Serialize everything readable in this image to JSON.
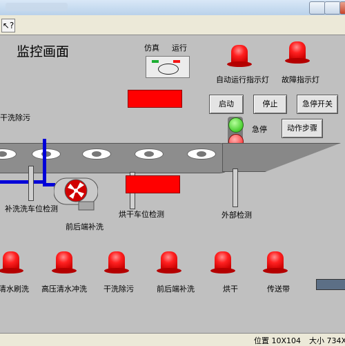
{
  "title_text": "监控画面",
  "mode_labels": {
    "sim": "仿真",
    "run": "运行"
  },
  "indicators": {
    "auto_run": "自动运行指示灯",
    "fault": "故障指示灯"
  },
  "buttons": {
    "start": "启动",
    "stop": "停止",
    "estop_switch": "急停开关",
    "action_steps": "动作步骤"
  },
  "estop_label": "急停",
  "process_labels": {
    "dry_clean": "干洗除污",
    "supplement_wash_detect": "补洗洗车位检测",
    "front_rear_wash": "前后端补洗",
    "dry_position_detect": "烘干车位检测",
    "external_detect": "外部检测"
  },
  "bottom_lamps": [
    "清水刷洗",
    "高压清水冲洗",
    "干洗除污",
    "前后端补洗",
    "烘干",
    "传送带"
  ],
  "status": {
    "position": "位置 10X104",
    "size": "大小 734X"
  },
  "colors": {
    "lamp_red": "#ff0000",
    "green_led": "#19b800"
  }
}
